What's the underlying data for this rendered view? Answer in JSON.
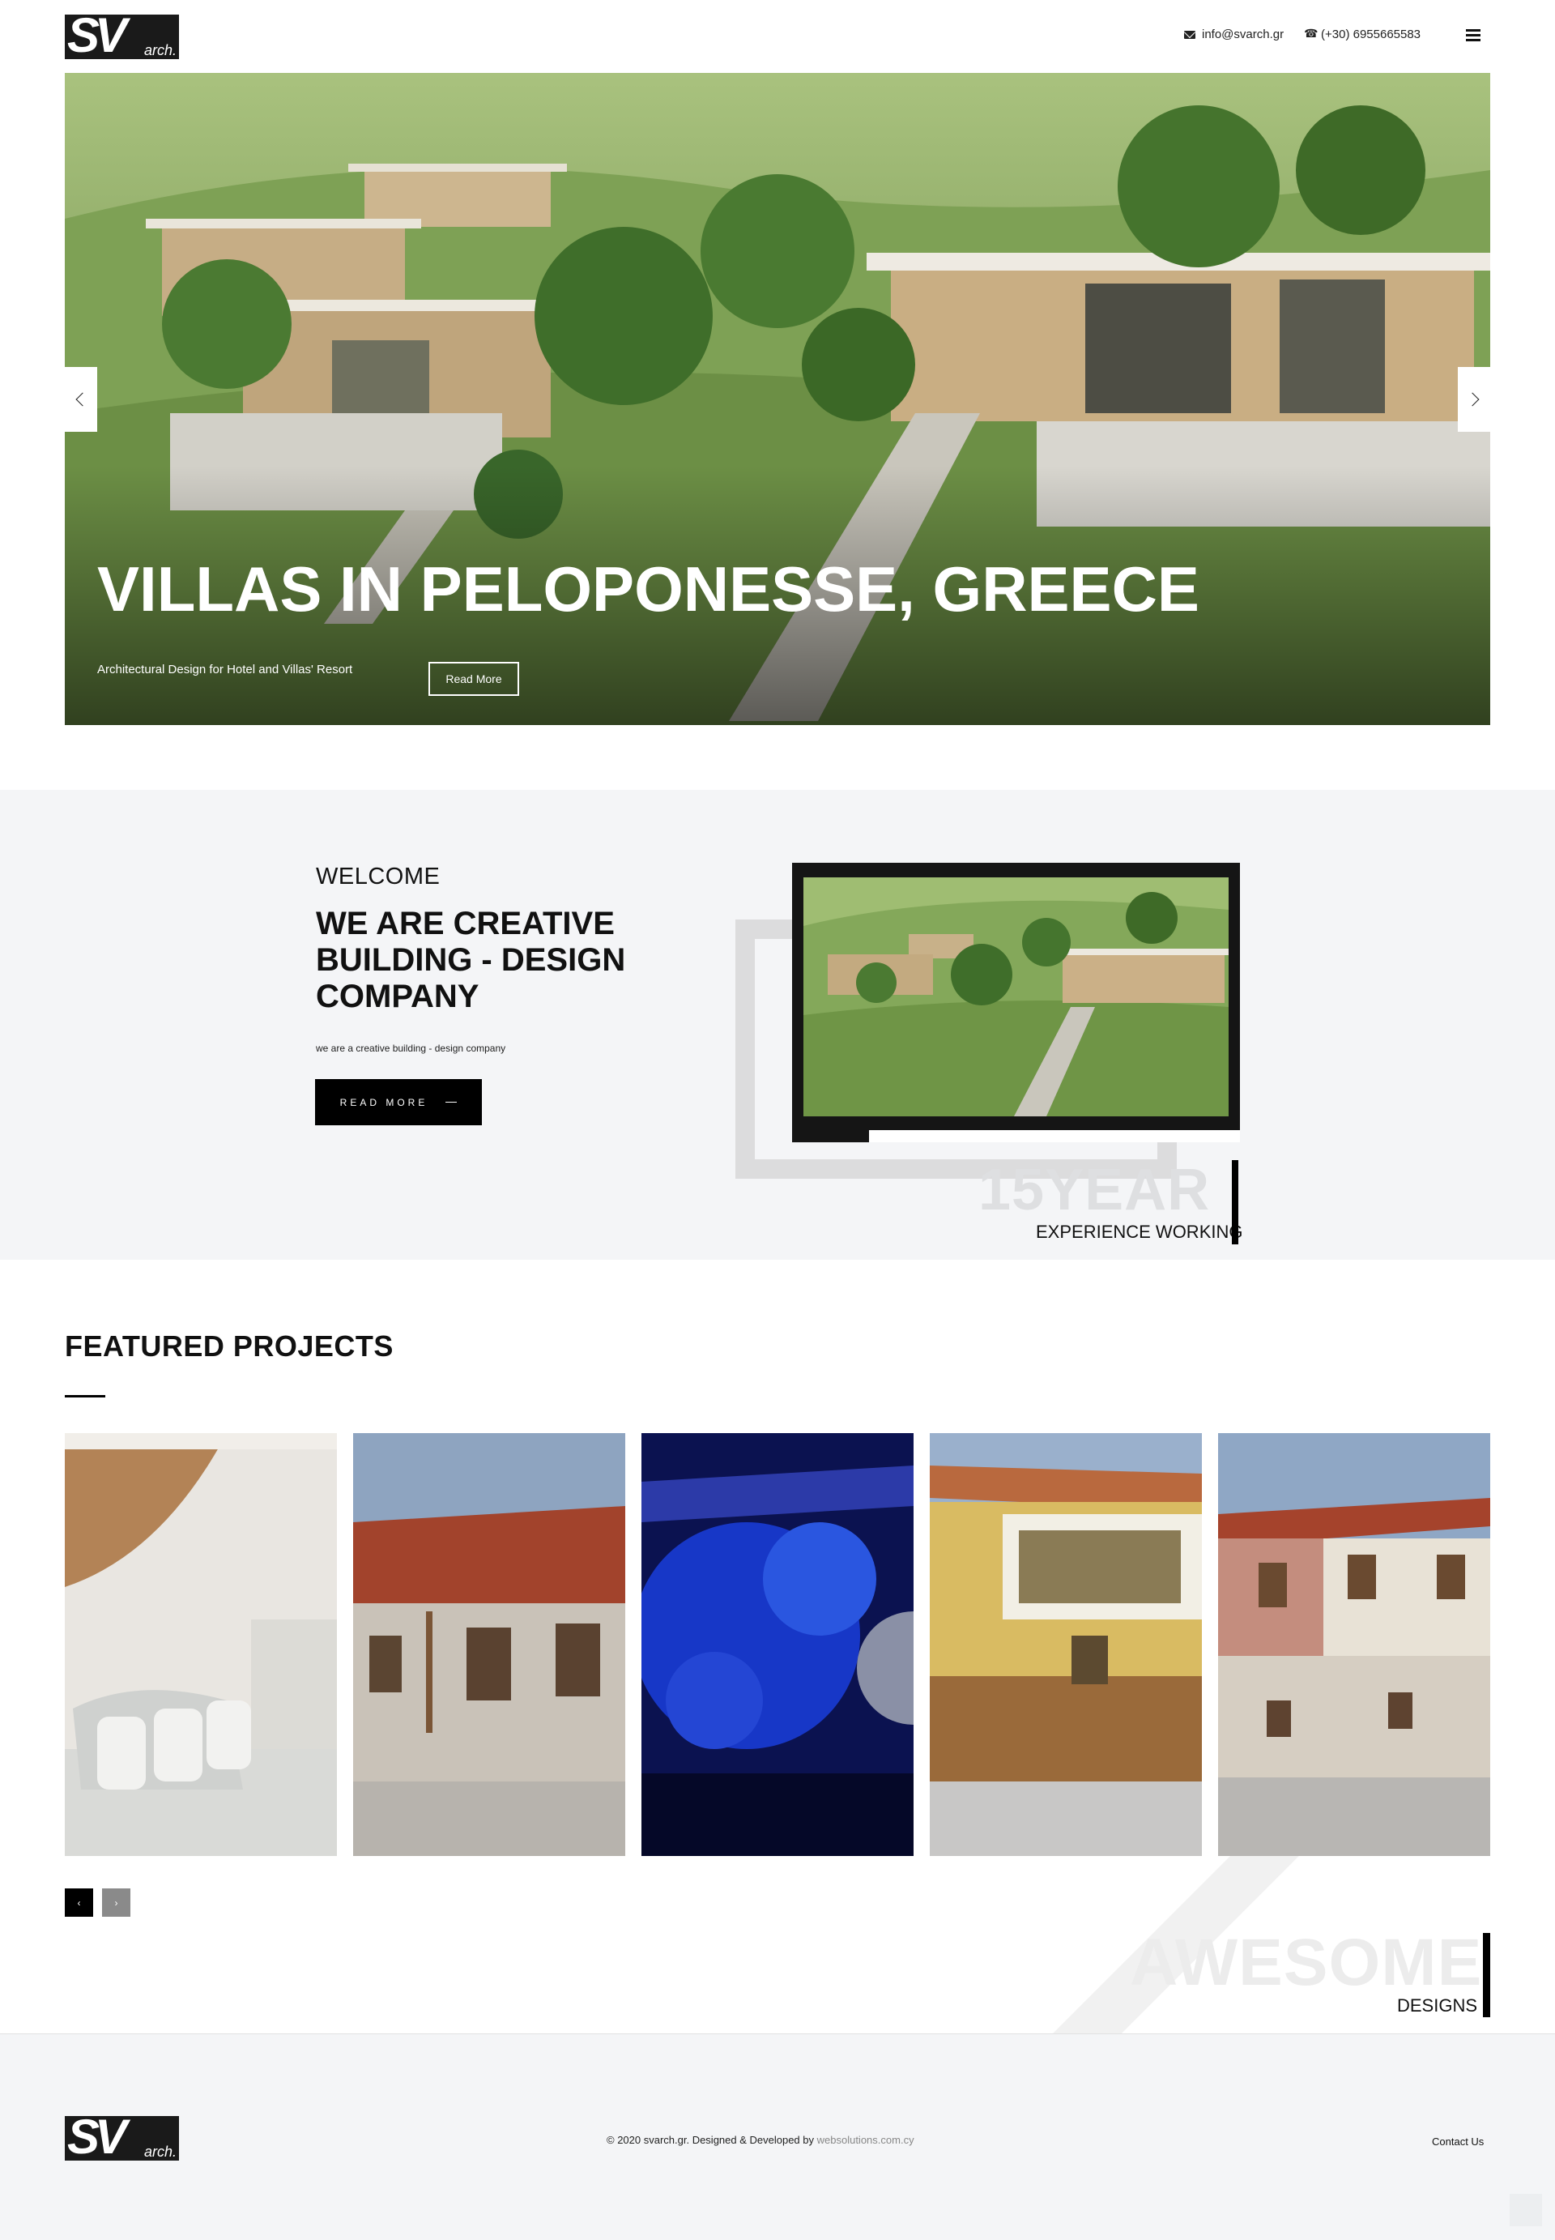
{
  "header": {
    "logo_main": "SV",
    "logo_sub": "arch.",
    "email": "info@svarch.gr",
    "phone": "(+30) 6955665583",
    "icons": [
      "envelope-icon",
      "phone-icon",
      "menu-icon"
    ]
  },
  "hero": {
    "title": "VILLAS IN PELOPONESSE, GREECE",
    "subtitle": "Architectural Design for Hotel and Villas' Resort",
    "button": "Read More",
    "icons": [
      "chevron-left-icon",
      "chevron-right-icon"
    ]
  },
  "welcome": {
    "label": "WELCOME",
    "heading": "WE ARE CREATIVE BUILDING - DESIGN COMPANY",
    "text": "we are a creative building - design company",
    "button": "READ MORE",
    "experience_number": "15YEAR",
    "experience_caption": "EXPERIENCE WORKING"
  },
  "featured": {
    "title": "FEATURED PROJECTS",
    "prev": "‹",
    "next": "›",
    "awesome_word": "AWESOME",
    "awesome_caption": "DESIGNS"
  },
  "footer": {
    "copyright": "© 2020 svarch.gr. Designed & Developed by ",
    "developer_link": "websolutions.com.cy",
    "contact": "Contact Us"
  },
  "colors": {
    "accent": "#000000",
    "section_bg": "#f4f5f7",
    "hero_green": "#6f8f4d"
  }
}
